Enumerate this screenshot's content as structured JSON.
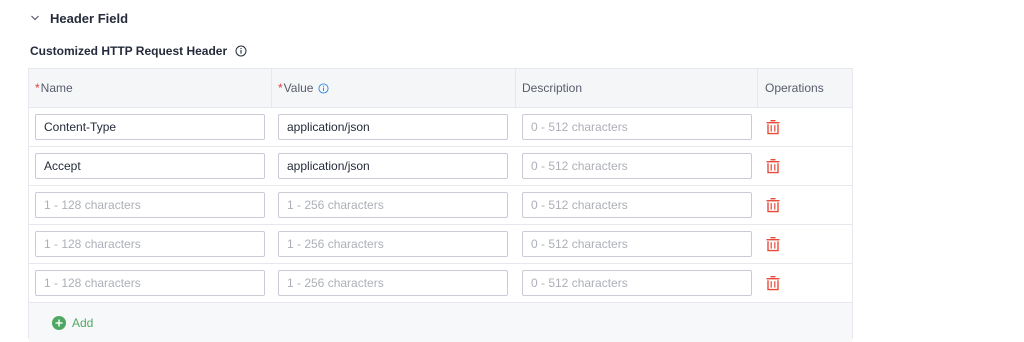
{
  "section": {
    "title": "Header Field"
  },
  "subsection": {
    "title": "Customized HTTP Request Header"
  },
  "table": {
    "columns": {
      "name": "Name",
      "value": "Value",
      "description": "Description",
      "operations": "Operations"
    },
    "required_marker": "*",
    "rows": [
      {
        "name": "Content-Type",
        "value": "application/json",
        "description": ""
      },
      {
        "name": "Accept",
        "value": "application/json",
        "description": ""
      },
      {
        "name": "",
        "value": "",
        "description": ""
      },
      {
        "name": "",
        "value": "",
        "description": ""
      },
      {
        "name": "",
        "value": "",
        "description": ""
      }
    ],
    "placeholders": {
      "name": "1 - 128 characters",
      "value": "1 - 256 characters",
      "description": "0 - 512 characters"
    },
    "add_label": "Add"
  },
  "colors": {
    "required": "#e33b3b",
    "info": "#2e8ae6",
    "delete": "#e84b3a",
    "add": "#4ea861"
  }
}
